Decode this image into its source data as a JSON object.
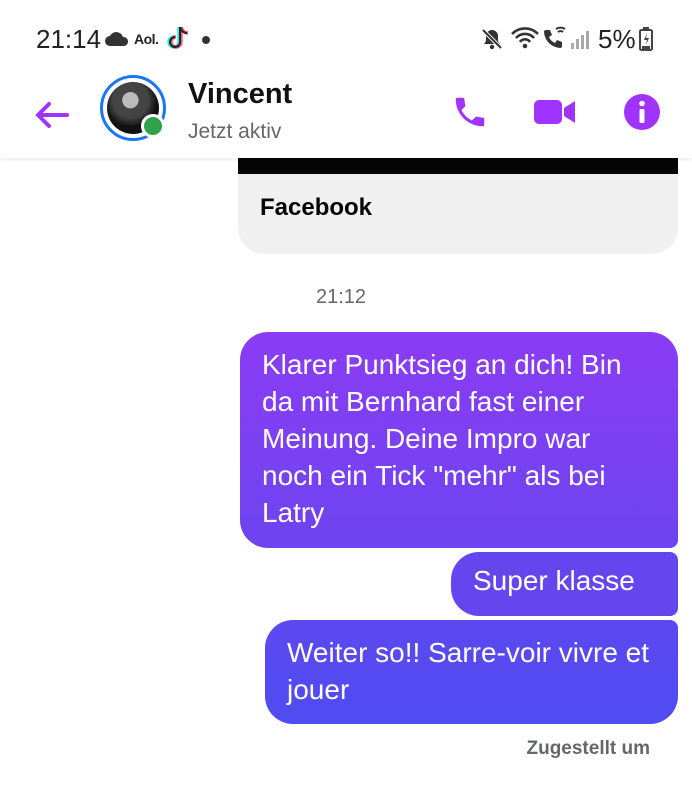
{
  "status_bar": {
    "time": "21:14",
    "aol_label": "Aol.",
    "battery_percent": "5%"
  },
  "header": {
    "contact_name": "Vincent",
    "contact_status": "Jetzt aktiv",
    "accent_color": "#a033ff",
    "online_color": "#31a24c"
  },
  "chat": {
    "shared_card_title": "Facebook",
    "timestamp": "21:12",
    "messages": [
      {
        "text": "Klarer Punktsieg an dich! Bin da mit Bernhard fast einer Meinung. Deine Impro war noch ein Tick \"mehr\" als bei Latry",
        "sender": "me"
      },
      {
        "text": "Super klasse",
        "sender": "me"
      },
      {
        "text": "Weiter so!! Sarre-voir vivre et jouer",
        "sender": "me"
      }
    ],
    "delivery_status": "Zugestellt um"
  },
  "icons": {
    "back": "arrow-left-icon",
    "phone": "phone-icon",
    "video": "video-camera-icon",
    "info": "info-icon"
  }
}
